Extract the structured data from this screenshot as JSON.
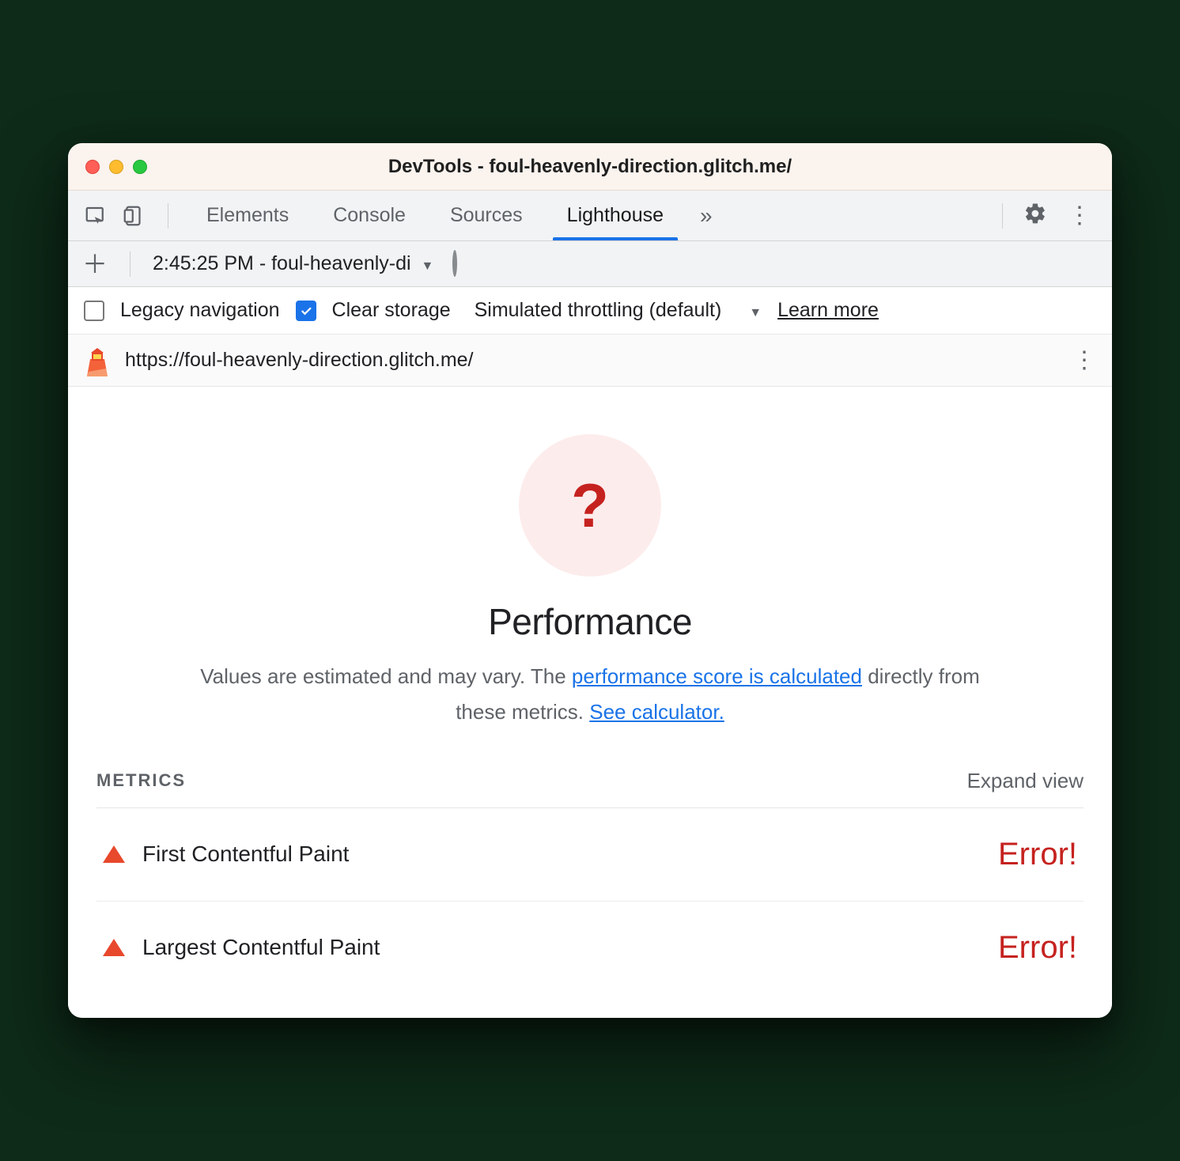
{
  "window": {
    "title": "DevTools - foul-heavenly-direction.glitch.me/"
  },
  "tabs": {
    "items": [
      "Elements",
      "Console",
      "Sources",
      "Lighthouse"
    ],
    "active": "Lighthouse"
  },
  "toolbar2": {
    "dropdown_text": "2:45:25 PM - foul-heavenly-di"
  },
  "options": {
    "legacy_label": "Legacy navigation",
    "clear_label": "Clear storage",
    "throttling_label": "Simulated throttling (default)",
    "learn_more": "Learn more"
  },
  "url": {
    "text": "https://foul-heavenly-direction.glitch.me/"
  },
  "report": {
    "score_symbol": "?",
    "title": "Performance",
    "desc_prefix": "Values are estimated and may vary. The ",
    "desc_link1": "performance score is calculated",
    "desc_mid": " directly from these metrics. ",
    "desc_link2": "See calculator.",
    "metrics_label": "METRICS",
    "expand_label": "Expand view",
    "metrics": [
      {
        "name": "First Contentful Paint",
        "value": "Error!"
      },
      {
        "name": "Largest Contentful Paint",
        "value": "Error!"
      }
    ]
  }
}
